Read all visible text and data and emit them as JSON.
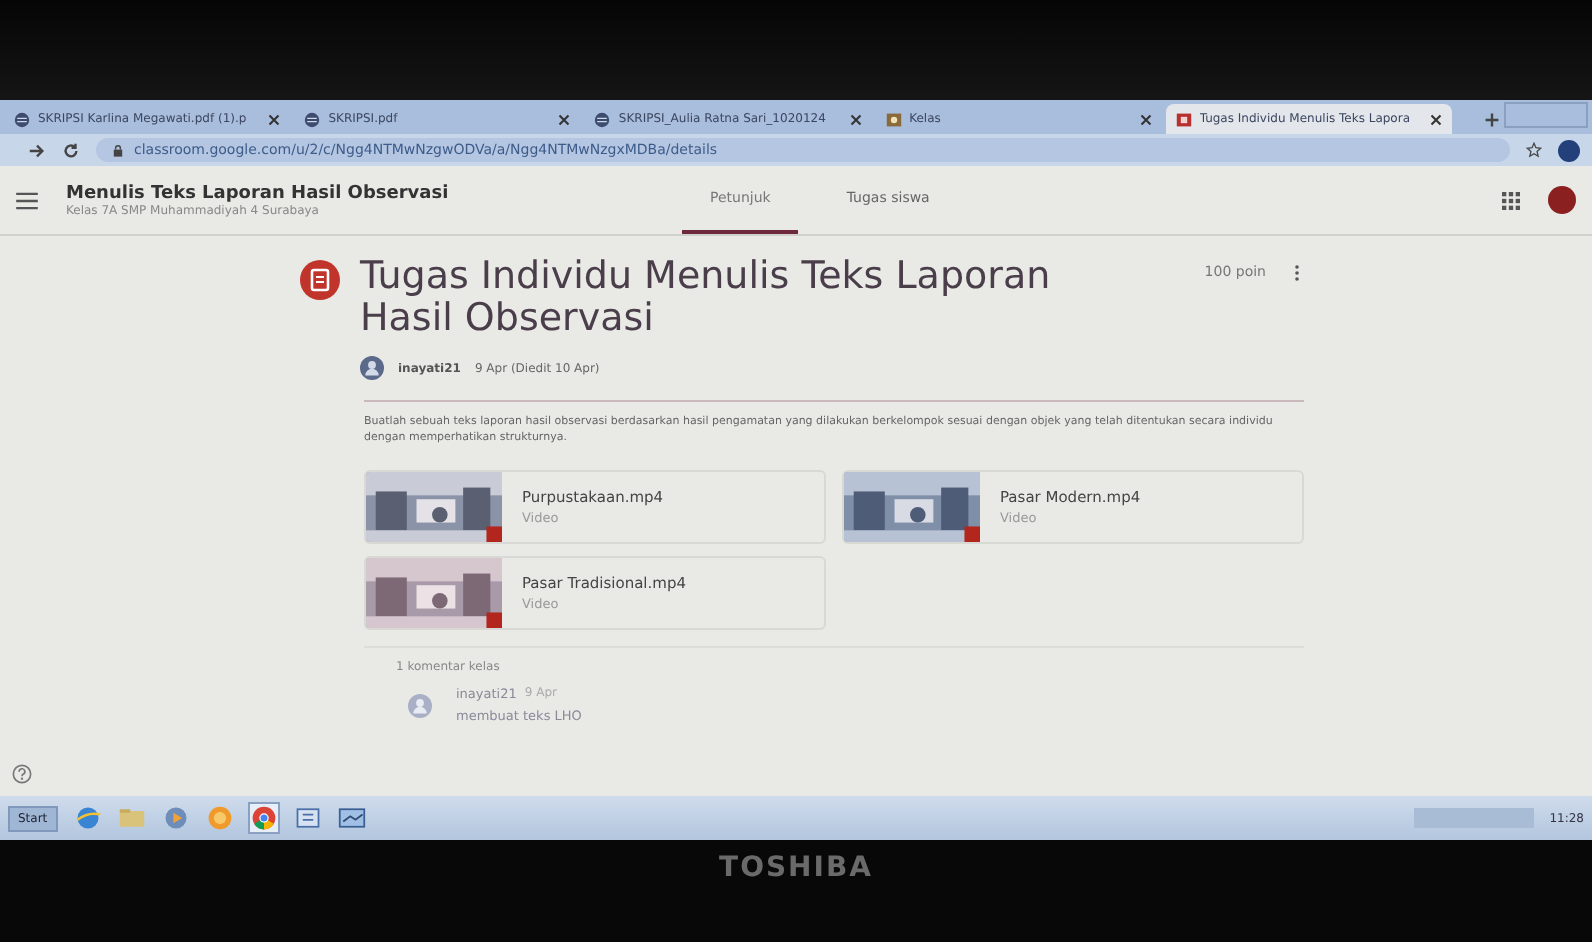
{
  "browser": {
    "tabs": [
      {
        "title": "SKRIPSI Karlina Megawati.pdf (1).p",
        "kind": "web",
        "selected": false
      },
      {
        "title": "SKRIPSI.pdf",
        "kind": "web",
        "selected": false
      },
      {
        "title": "SKRIPSI_Aulia Ratna Sari_1020124",
        "kind": "web",
        "selected": false
      },
      {
        "title": "Kelas",
        "kind": "class",
        "selected": false
      },
      {
        "title": "Tugas Individu Menulis Teks Lapora",
        "kind": "classroom",
        "selected": true
      }
    ],
    "url": "classroom.google.com/u/2/c/Ngg4NTMwNzgwODVa/a/Ngg4NTMwNzgxMDBa/details"
  },
  "header": {
    "title": "Menulis Teks Laporan Hasil Observasi",
    "subtitle": "Kelas 7A SMP Muhammadiyah 4 Surabaya",
    "tabs": [
      {
        "label": "Petunjuk",
        "selected": true
      },
      {
        "label": "Tugas siswa",
        "selected": false
      }
    ]
  },
  "assignment": {
    "title": "Tugas Individu Menulis Teks Laporan Hasil Observasi",
    "points": "100 poin",
    "author": "inayati21",
    "date": "9 Apr (Diedit 10 Apr)",
    "description": "Buatlah sebuah teks laporan hasil observasi berdasarkan hasil pengamatan yang dilakukan berkelompok sesuai dengan objek yang telah ditentukan secara individu dengan memperhatikan strukturnya.",
    "attachments": [
      {
        "name": "Purpustakaan.mp4",
        "type": "Video"
      },
      {
        "name": "Pasar Modern.mp4",
        "type": "Video"
      },
      {
        "name": "Pasar Tradisional.mp4",
        "type": "Video"
      }
    ]
  },
  "comments": {
    "heading": "1 komentar kelas",
    "items": [
      {
        "author": "inayati21",
        "date": "9 Apr",
        "text": "membuat teks LHO"
      }
    ]
  },
  "taskbar": {
    "start": "Start",
    "clock": "11:28"
  },
  "bezel": {
    "brand": "TOSHIBA"
  }
}
